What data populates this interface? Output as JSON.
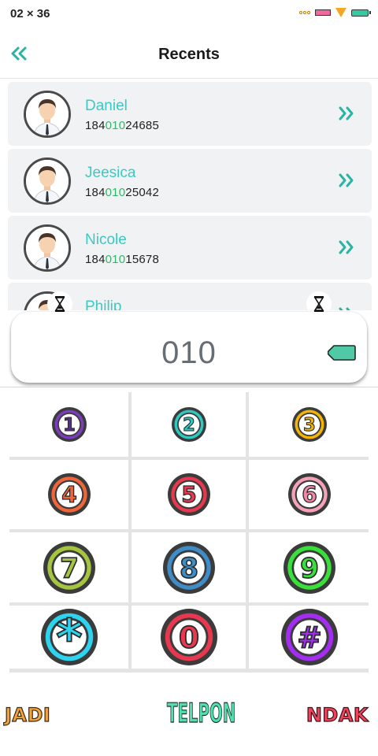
{
  "status_bar": {
    "time": "02 × 36"
  },
  "header": {
    "title": "Recents",
    "back_icon": "double-chevron-left-icon"
  },
  "accent_color": "#3cc9c2",
  "match_color": "#2fb86a",
  "contacts": [
    {
      "name": "Daniel",
      "number_prefix": "184",
      "number_match": "010",
      "number_suffix": "24685"
    },
    {
      "name": "Jeesica",
      "number_prefix": "184",
      "number_match": "010",
      "number_suffix": "25042"
    },
    {
      "name": "Nicole",
      "number_prefix": "184",
      "number_match": "010",
      "number_suffix": "15678"
    },
    {
      "name": "Philip",
      "number_prefix": "",
      "number_match": "",
      "number_suffix": ""
    }
  ],
  "dial_input": {
    "value": "010"
  },
  "keypad": [
    {
      "label": "1",
      "fill": "#ffffff",
      "ring": "#7d3cc0",
      "text": "#5b2a9a"
    },
    {
      "label": "2",
      "fill": "#ffffff",
      "ring": "#2ec9c1",
      "text": "#2ec9c1"
    },
    {
      "label": "3",
      "fill": "#ffffff",
      "ring": "#f4b400",
      "text": "#f4b400"
    },
    {
      "label": "4",
      "fill": "#ffffff",
      "ring": "#f0653a",
      "text": "#f0653a"
    },
    {
      "label": "5",
      "fill": "#ffffff",
      "ring": "#e8384f",
      "text": "#e8384f"
    },
    {
      "label": "6",
      "fill": "#ffffff",
      "ring": "#f4a2b8",
      "text": "#f288a6"
    },
    {
      "label": "7",
      "fill": "#ffffff",
      "ring": "#a5c440",
      "text": "#a5c440"
    },
    {
      "label": "8",
      "fill": "#ffffff",
      "ring": "#3f8cc7",
      "text": "#3f8cc7"
    },
    {
      "label": "9",
      "fill": "#ffffff",
      "ring": "#3ae03a",
      "text": "#3ae03a"
    },
    {
      "label": "*",
      "fill": "#ffffff",
      "ring": "#2ed3ef",
      "text": "#2ed3ef"
    },
    {
      "label": "0",
      "fill": "#ffffff",
      "ring": "#e8384f",
      "text": "#e8384f"
    },
    {
      "label": "#",
      "fill": "#ffffff",
      "ring": "#a32df0",
      "text": "#a32df0"
    }
  ],
  "actions": {
    "left": "JADI",
    "center": "TELPON",
    "right": "NDAK"
  }
}
